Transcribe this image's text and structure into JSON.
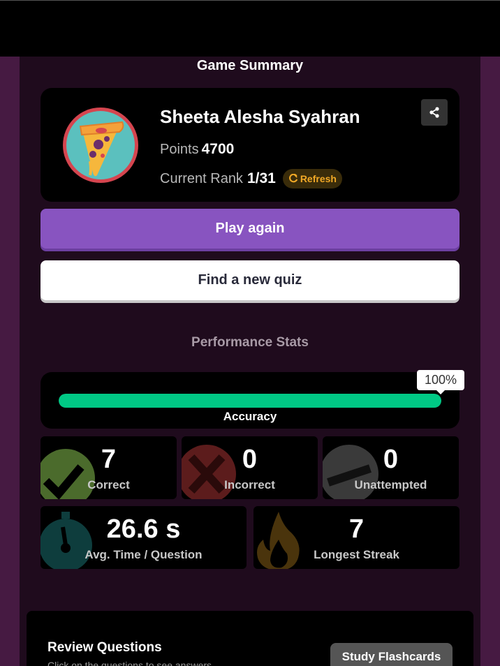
{
  "page": {
    "title": "Game Summary"
  },
  "player": {
    "name": "Sheeta Alesha Syahran",
    "points_label": "Points",
    "points": "4700",
    "rank_label": "Current Rank",
    "rank": "1/31",
    "refresh_label": "Refresh",
    "avatar": "pizza-slice"
  },
  "actions": {
    "play_again": "Play again",
    "find_quiz": "Find a new quiz"
  },
  "performance": {
    "title": "Performance Stats",
    "accuracy_label": "Accuracy",
    "accuracy_value": "100%",
    "accuracy_fraction": 1.0,
    "stats": [
      {
        "value": "7",
        "label": "Correct",
        "icon": "check-icon",
        "color": "#4b6b2c"
      },
      {
        "value": "0",
        "label": "Incorrect",
        "icon": "cross-icon",
        "color": "#5c1c1c"
      },
      {
        "value": "0",
        "label": "Unattempted",
        "icon": "dash-icon",
        "color": "#3a3a3a"
      }
    ],
    "time": {
      "value": "26.6 s",
      "label": "Avg. Time / Question",
      "icon": "stopwatch-icon"
    },
    "streak": {
      "value": "7",
      "label": "Longest Streak",
      "icon": "flame-icon"
    }
  },
  "review": {
    "title": "Review Questions",
    "subtitle": "Click on the questions to see answers",
    "flashcards": "Study Flashcards"
  },
  "colors": {
    "accent": "#8854c0",
    "success": "#00c985",
    "refresh": "#f0a826"
  }
}
